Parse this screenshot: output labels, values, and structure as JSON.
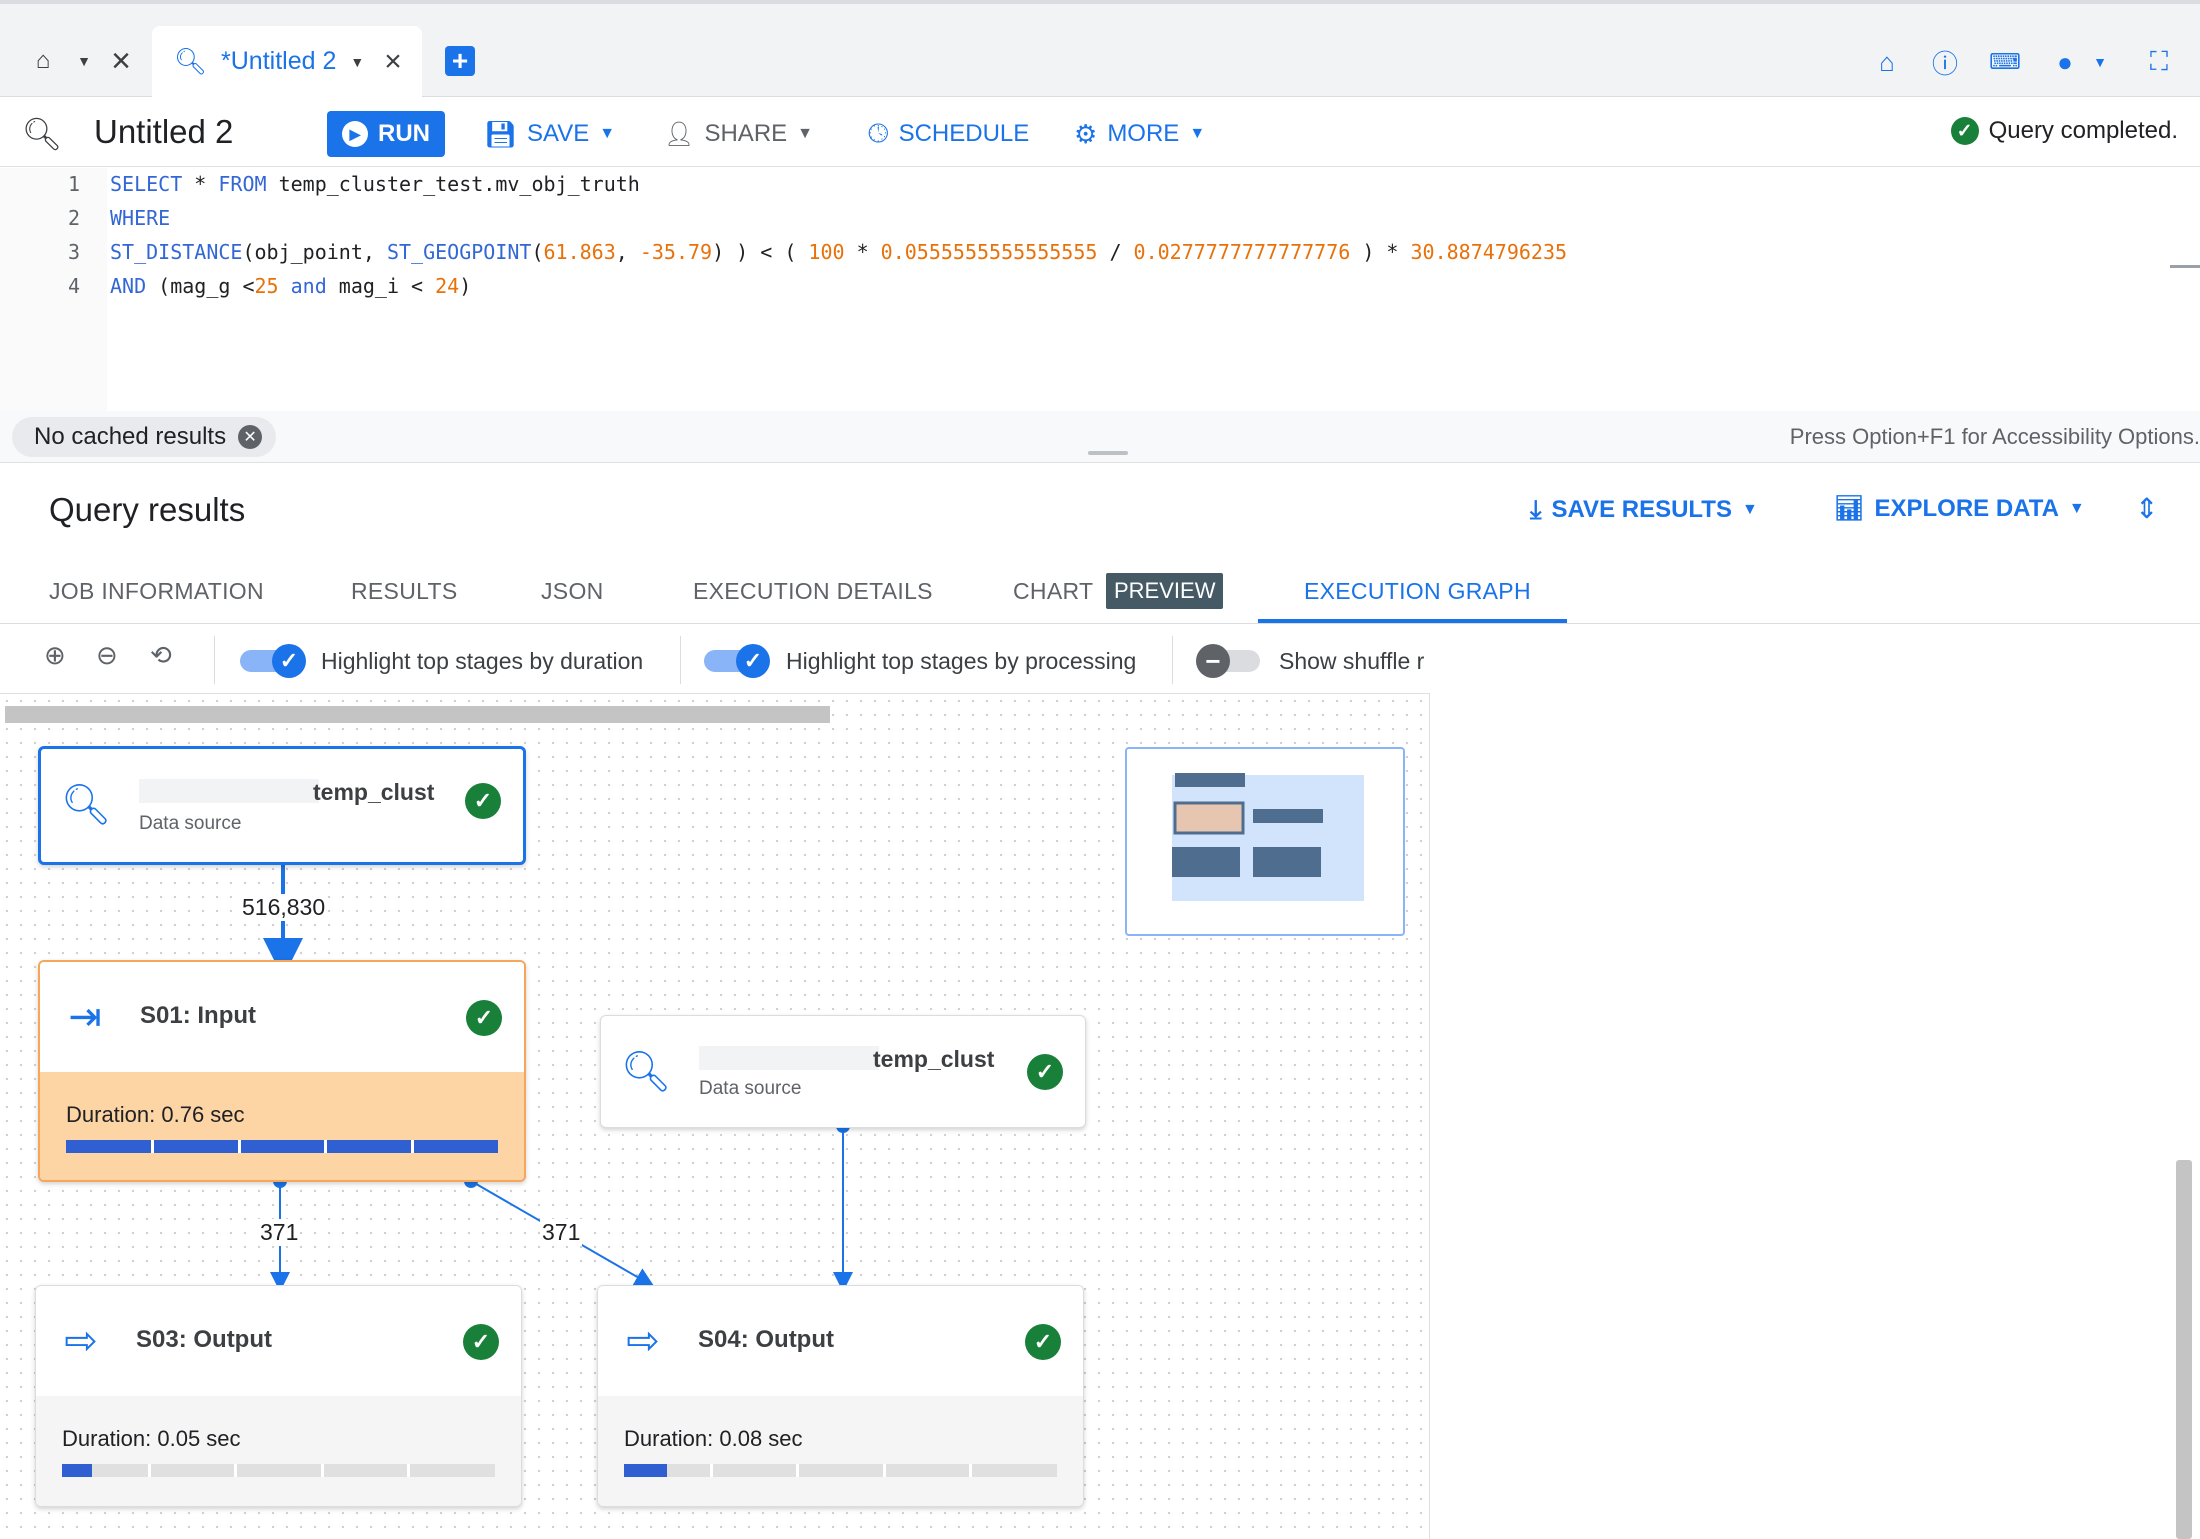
{
  "tabs": {
    "active_label": "*Untitled 2"
  },
  "toolbar": {
    "title": "Untitled 2",
    "run": "RUN",
    "save": "SAVE",
    "share": "SHARE",
    "schedule": "SCHEDULE",
    "more": "MORE",
    "status": "Query completed."
  },
  "editor": {
    "line_numbers": [
      "1",
      "2",
      "3",
      "4"
    ]
  },
  "status_row": {
    "chip": "No cached results",
    "accessibility": "Press Option+F1 for Accessibility Options."
  },
  "results": {
    "title": "Query results",
    "save_results": "SAVE RESULTS",
    "explore_data": "EXPLORE DATA",
    "tabs": [
      "JOB INFORMATION",
      "RESULTS",
      "JSON",
      "EXECUTION DETAILS",
      "CHART",
      "EXECUTION GRAPH"
    ],
    "preview_badge": "PREVIEW"
  },
  "graph_toolbar": {
    "toggle_duration": "Highlight top stages by duration",
    "toggle_processing": "Highlight top stages by processing",
    "toggle_shuffle": "Show shuffle r"
  },
  "graph": {
    "nodes": {
      "ds1": {
        "name": "temp_clust",
        "sub": "Data source"
      },
      "s01": {
        "title": "S01: Input",
        "duration": "Duration: 0.76 sec",
        "progress": 1.0
      },
      "ds2": {
        "name": "temp_clust",
        "sub": "Data source"
      },
      "s03": {
        "title": "S03: Output",
        "duration": "Duration: 0.05 sec",
        "progress": 0.07
      },
      "s04": {
        "title": "S04: Output",
        "duration": "Duration: 0.08 sec",
        "progress": 0.1
      }
    },
    "edges": {
      "ds1_s01": "516,830",
      "s01_s03": "371",
      "s01_s04": "371"
    }
  },
  "colors": {
    "accent": "#1a73e8",
    "success": "#188038",
    "highlight": "#fdd4a4",
    "progress": "#2f5fd0"
  }
}
